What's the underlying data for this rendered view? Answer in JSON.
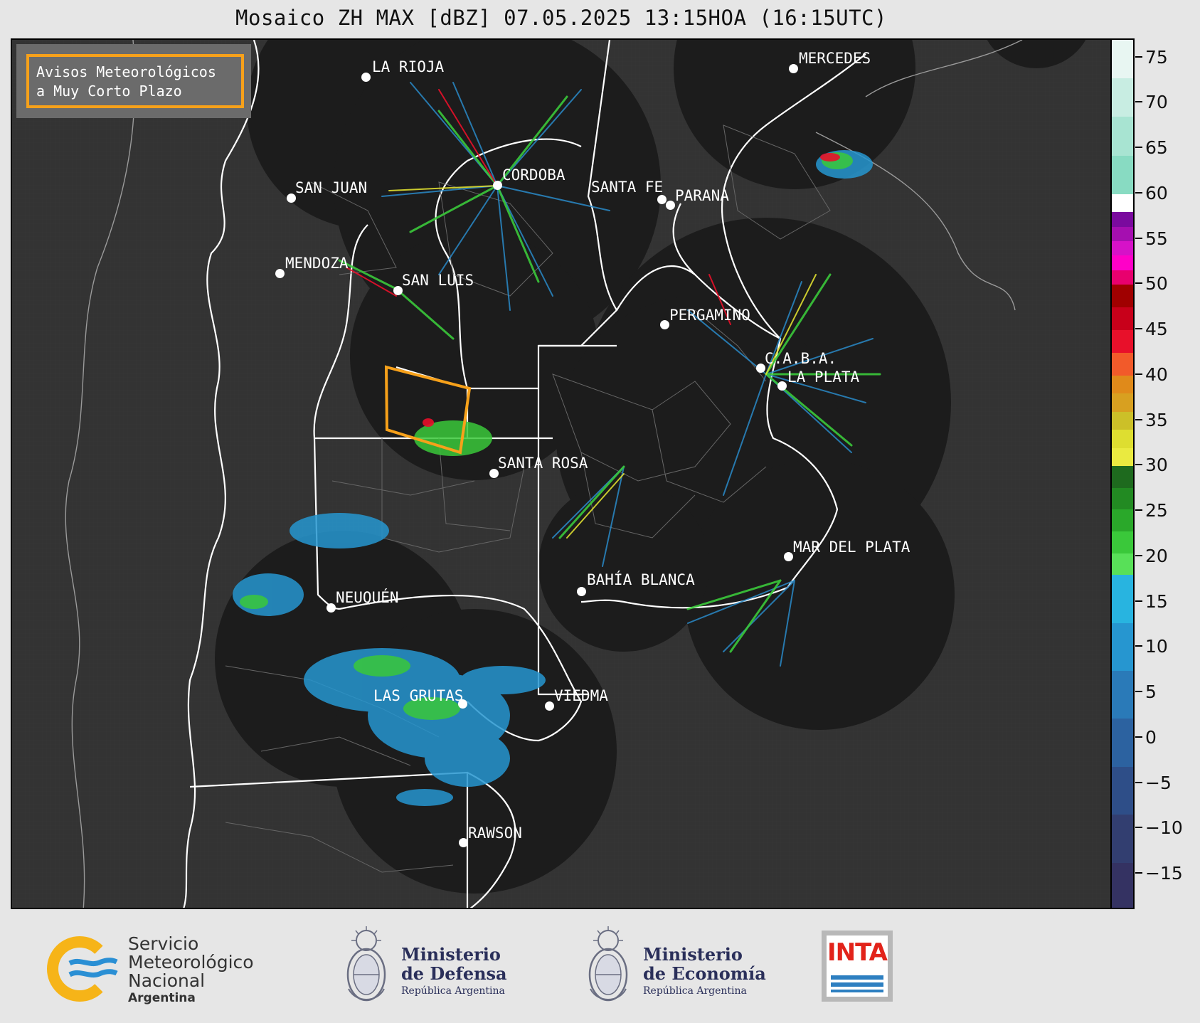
{
  "title": "Mosaico ZH MAX [dBZ] 07.05.2025 13:15HOA (16:15UTC)",
  "alert_box": {
    "line1": "Avisos Meteorológicos",
    "line2": "a Muy Corto Plazo",
    "border_color": "#f7a11a"
  },
  "cities": [
    {
      "id": "la-rioja",
      "name": "LA RIOJA"
    },
    {
      "id": "mercedes",
      "name": "MERCEDES"
    },
    {
      "id": "cordoba",
      "name": "CORDOBA"
    },
    {
      "id": "san-juan",
      "name": "SAN JUAN"
    },
    {
      "id": "santa-fe",
      "name": "SANTA FE"
    },
    {
      "id": "parana",
      "name": "PARANA"
    },
    {
      "id": "mendoza",
      "name": "MENDOZA"
    },
    {
      "id": "san-luis",
      "name": "SAN LUIS"
    },
    {
      "id": "pergamino",
      "name": "PERGAMINO"
    },
    {
      "id": "caba",
      "name": "C.A.B.A."
    },
    {
      "id": "la-plata",
      "name": "LA PLATA"
    },
    {
      "id": "santa-rosa",
      "name": "SANTA ROSA"
    },
    {
      "id": "mar-del-plata",
      "name": "MAR DEL PLATA"
    },
    {
      "id": "bahia-blanca",
      "name": "BAHÍA BLANCA"
    },
    {
      "id": "neuquen",
      "name": "NEUQUÉN"
    },
    {
      "id": "las-grutas",
      "name": "LAS GRUTAS"
    },
    {
      "id": "viedma",
      "name": "VIEDMA"
    },
    {
      "id": "rawson",
      "name": "RAWSON"
    }
  ],
  "colorbar": {
    "unit": "dBZ",
    "min": -19,
    "max": 77,
    "ticks": [
      "75",
      "70",
      "65",
      "60",
      "55",
      "50",
      "45",
      "40",
      "35",
      "30",
      "25",
      "20",
      "15",
      "10",
      "5",
      "0",
      "−5",
      "−10",
      "−15"
    ],
    "tick_values": [
      75,
      70,
      65,
      60,
      55,
      50,
      45,
      40,
      35,
      30,
      25,
      20,
      15,
      10,
      5,
      0,
      -5,
      -10,
      -15
    ],
    "bands": [
      {
        "from": 60,
        "to": 77,
        "colors": [
          "#e8f6f2",
          "#c8ede2",
          "#a8e4d2",
          "#88dbc2"
        ]
      },
      {
        "from": 58,
        "to": 60,
        "colors": [
          "#ffffff"
        ]
      },
      {
        "from": 50,
        "to": 58,
        "colors": [
          "#7a0a9e",
          "#a50fb0",
          "#d612c8",
          "#ff00c8",
          "#e8006e"
        ]
      },
      {
        "from": 40,
        "to": 50,
        "colors": [
          "#a00000",
          "#c8001a",
          "#e8102a",
          "#f25a2a"
        ]
      },
      {
        "from": 30,
        "to": 40,
        "colors": [
          "#e08a1a",
          "#d8a020",
          "#ccc028",
          "#dede30",
          "#eaea40"
        ]
      },
      {
        "from": 18,
        "to": 30,
        "colors": [
          "#1e6a1e",
          "#228a22",
          "#2aa82a",
          "#3ac83a",
          "#58e058"
        ]
      },
      {
        "from": -19,
        "to": 18,
        "colors": [
          "#28b4e0",
          "#2696d0",
          "#2a7ab8",
          "#2c62a0",
          "#2e4e88",
          "#323e70",
          "#343262"
        ]
      }
    ]
  },
  "footer": {
    "smn": {
      "line1": "Servicio",
      "line2": "Meteorológico",
      "line3": "Nacional",
      "line4": "Argentina"
    },
    "defensa": {
      "line1": "Ministerio",
      "line2": "de Defensa",
      "line3": "República Argentina"
    },
    "economia": {
      "line1": "Ministerio",
      "line2": "de Economía",
      "line3": "República Argentina"
    },
    "inta": {
      "word": "INTA"
    }
  }
}
